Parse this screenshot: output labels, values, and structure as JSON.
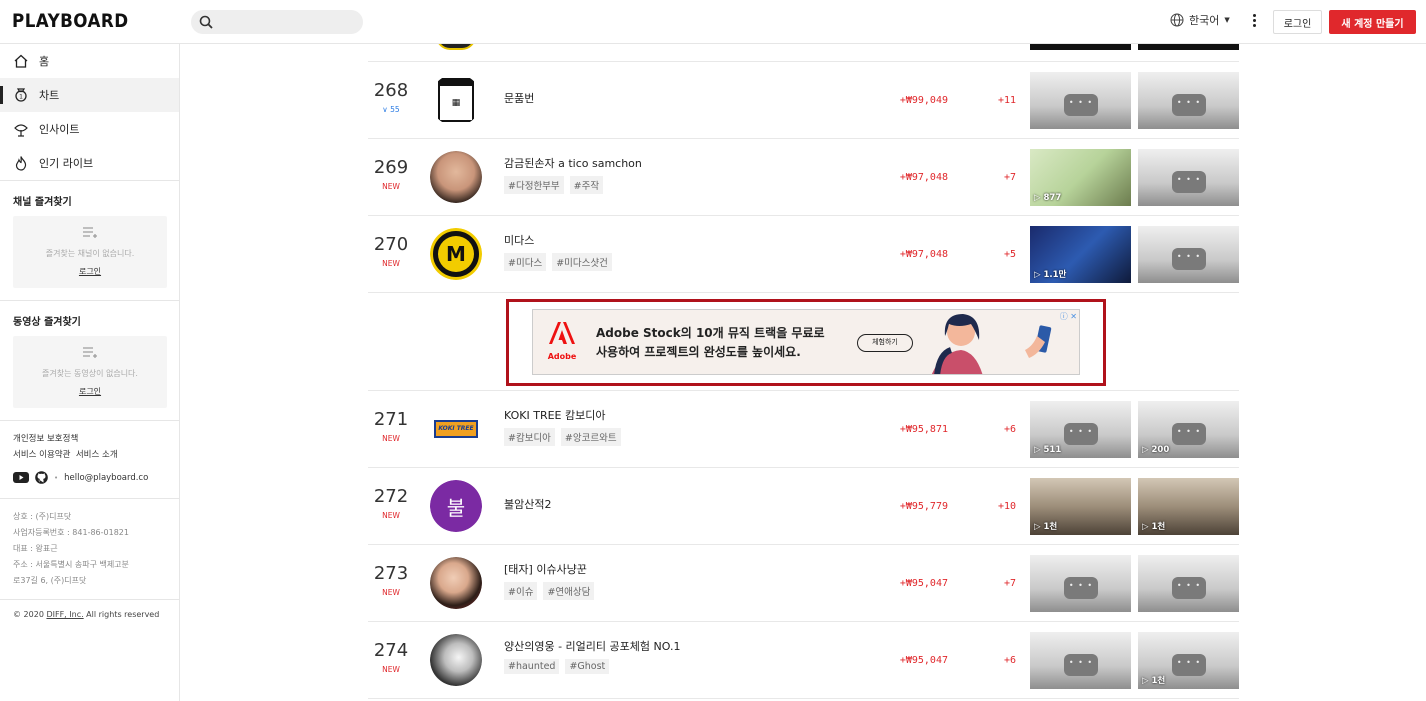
{
  "app": {
    "logo": "PLAYBOARD"
  },
  "header": {
    "search_placeholder": "",
    "language": "한국어",
    "login": "로그인",
    "signup": "새 계정 만들기"
  },
  "sidebar": {
    "nav": [
      {
        "label": "홈",
        "icon": "home-icon"
      },
      {
        "label": "차트",
        "icon": "trophy-icon"
      },
      {
        "label": "인사이트",
        "icon": "insight-icon"
      },
      {
        "label": "인기 라이브",
        "icon": "flame-icon"
      }
    ],
    "channel_fav": {
      "title": "채널 즐겨찾기",
      "empty": "즐겨찾는 채널이 없습니다.",
      "login": "로그인"
    },
    "video_fav": {
      "title": "동영상 즐겨찾기",
      "empty": "즐겨찾는 동영상이 없습니다.",
      "login": "로그인"
    },
    "links": {
      "privacy": "개인정보 보호정책",
      "terms": "서비스 이용약관",
      "about": "서비스 소개"
    },
    "email": "hello@playboard.co",
    "company": {
      "name": "상호 : (주)디프닷",
      "reg": "사업자등록번호 : 841-86-01821",
      "ceo": "대표 : 왕표근",
      "addr1": "주소 : 서울특별시 송파구 백제고분",
      "addr2": "로37길 6, (주)디프닷"
    },
    "copyright_pre": "© 2020 ",
    "copyright_link": "DIFF, Inc.",
    "copyright_post": " All rights reserved"
  },
  "rows_before_ad": [
    {
      "rank": "268",
      "change": "55",
      "change_dir": "down",
      "name": "문품번",
      "tags": [],
      "amount": "+₩99,049",
      "delta": "+11",
      "thumbs": [
        {
          "views": "",
          "style": ""
        },
        {
          "views": "",
          "style": ""
        }
      ]
    },
    {
      "rank": "269",
      "change": "NEW",
      "change_dir": "new",
      "name": "감금된손자 a tico samchon",
      "tags": [
        "#다정한부부",
        "#주작"
      ],
      "amount": "+₩97,048",
      "delta": "+7",
      "thumbs": [
        {
          "views": "▷ 877",
          "style": "photo-a"
        },
        {
          "views": "",
          "style": ""
        }
      ]
    },
    {
      "rank": "270",
      "change": "NEW",
      "change_dir": "new",
      "name": "미다스",
      "tags": [
        "#미다스",
        "#미다스샷건"
      ],
      "amount": "+₩97,048",
      "delta": "+5",
      "thumbs": [
        {
          "views": "▷ 1.1만",
          "style": "photo-b"
        },
        {
          "views": "",
          "style": ""
        }
      ]
    }
  ],
  "ad": {
    "brand": "Adobe",
    "line1": "Adobe Stock의 10개 뮤직 트랙을 무료로",
    "line2": "사용하여 프로젝트의 완성도를 높이세요.",
    "cta": "체험하기",
    "close": "ⓘ ✕"
  },
  "rows_after_ad": [
    {
      "rank": "271",
      "change": "NEW",
      "change_dir": "new",
      "name": "KOKI TREE 캄보디아",
      "tags": [
        "#캄보디아",
        "#앙코르와트"
      ],
      "amount": "+₩95,871",
      "delta": "+6",
      "thumbs": [
        {
          "views": "▷ 511",
          "style": ""
        },
        {
          "views": "▷ 200",
          "style": ""
        }
      ]
    },
    {
      "rank": "272",
      "change": "NEW",
      "change_dir": "new",
      "name": "불암산적2",
      "tags": [],
      "amount": "+₩95,779",
      "delta": "+10",
      "thumbs": [
        {
          "views": "▷ 1천",
          "style": "photo-c"
        },
        {
          "views": "▷ 1천",
          "style": "photo-c"
        }
      ]
    },
    {
      "rank": "273",
      "change": "NEW",
      "change_dir": "new",
      "name": "[태자] 이슈사냥꾼",
      "tags": [
        "#이슈",
        "#연애상담"
      ],
      "amount": "+₩95,047",
      "delta": "+7",
      "thumbs": [
        {
          "views": "",
          "style": ""
        },
        {
          "views": "",
          "style": ""
        }
      ]
    },
    {
      "rank": "274",
      "change": "NEW",
      "change_dir": "new",
      "name": "양산의영웅 - 리얼리티 공포체험 NO.1",
      "tags": [
        "#haunted",
        "#Ghost"
      ],
      "amount": "+₩95,047",
      "delta": "+6",
      "thumbs": [
        {
          "views": "",
          "style": ""
        },
        {
          "views": "▷ 1천",
          "style": ""
        }
      ]
    }
  ],
  "avatar_letter_272": "불",
  "colors": {
    "accent": "#e0282c",
    "down": "#2a7be4",
    "ad_border": "#b0121b"
  }
}
